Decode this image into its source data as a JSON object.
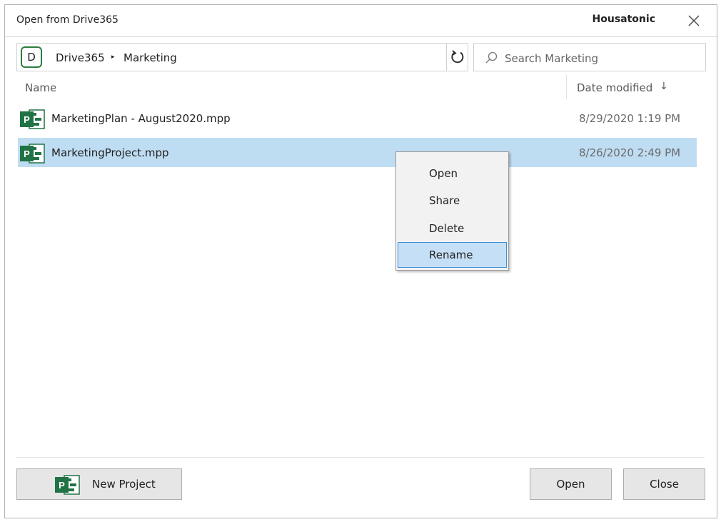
{
  "window": {
    "title": "Open from Drive365",
    "account_name": "Housatonic"
  },
  "breadcrumb": {
    "drive_badge": "D",
    "root": "Drive365",
    "separator": "▸",
    "current": "Marketing"
  },
  "search": {
    "placeholder": "Search Marketing"
  },
  "columns": {
    "name": "Name",
    "date_modified": "Date modified",
    "sort_indicator": "↓"
  },
  "files": [
    {
      "name": "MarketingPlan - August2020.mpp",
      "date": "8/29/2020 1:19 PM",
      "icon": "project-file-icon",
      "selected": false
    },
    {
      "name": "MarketingProject.mpp",
      "date": "8/26/2020 2:49 PM",
      "icon": "project-file-icon",
      "selected": true
    }
  ],
  "context_menu": {
    "items": [
      "Open",
      "Share",
      "Delete",
      "Rename"
    ],
    "highlighted": "Rename"
  },
  "buttons": {
    "new_project": "New Project",
    "open": "Open",
    "close": "Close"
  },
  "colors": {
    "accent_green": "#217346",
    "selection": "#bedcf2",
    "menu_highlight": "#c5dff6",
    "menu_highlight_border": "#3f8fd9"
  }
}
